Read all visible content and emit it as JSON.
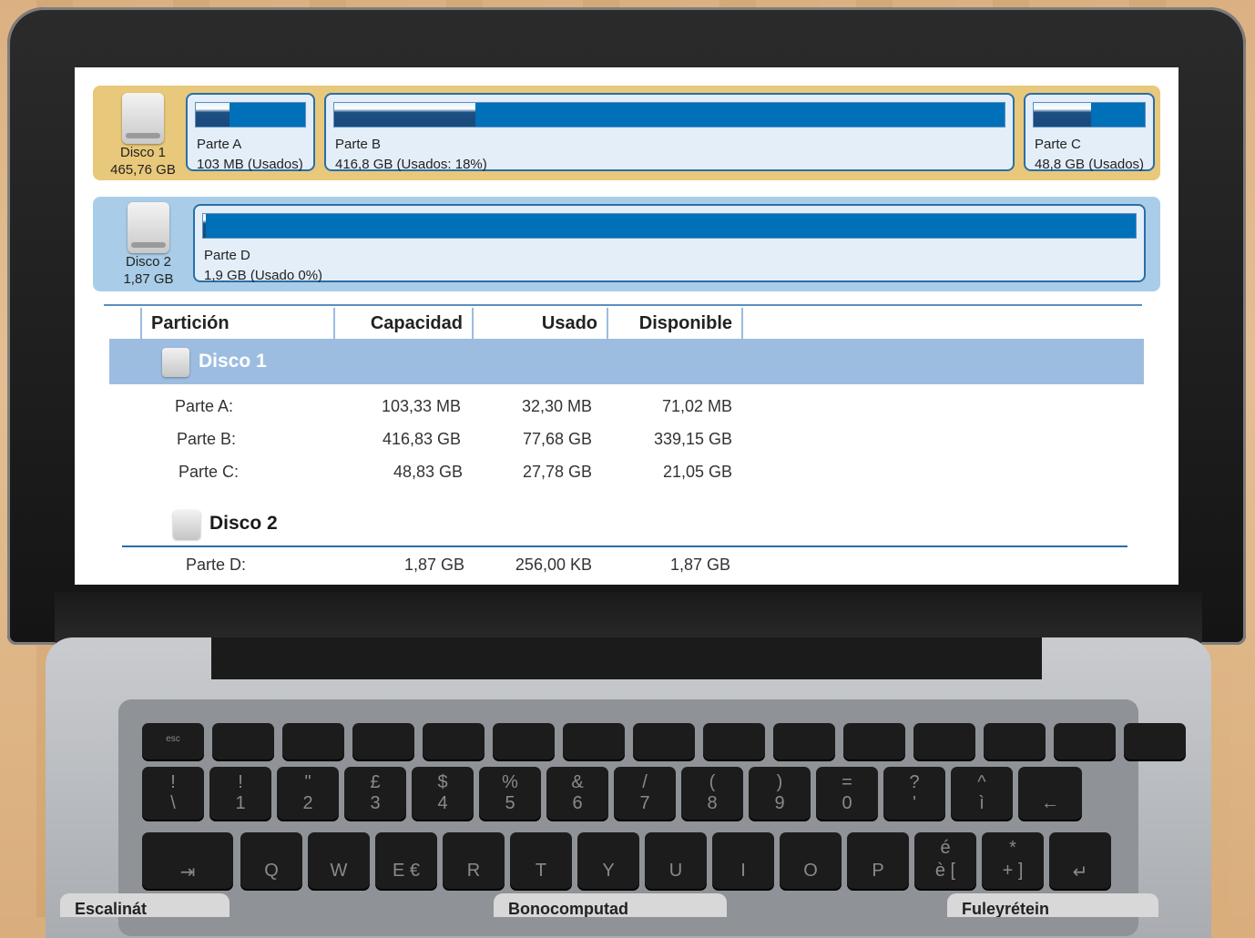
{
  "disks": [
    {
      "name": "Disco 1",
      "size": "465,76 GB",
      "partitions": [
        {
          "name": "Parte A",
          "info": "103 MB (Usados)",
          "used_fraction": 0.31
        },
        {
          "name": "Parte B",
          "info": "416,8 GB (Usados: 18%)",
          "used_fraction": 0.21
        },
        {
          "name": "Parte C",
          "info": "48,8 GB (Usados)",
          "used_fraction": 0.52
        }
      ]
    },
    {
      "name": "Disco 2",
      "size": "1,87 GB",
      "partitions": [
        {
          "name": "Parte D",
          "info": "1,9 GB (Usado 0%)",
          "used_fraction": 0.0
        }
      ]
    }
  ],
  "table": {
    "headers": [
      "Partición",
      "Capacidad",
      "Usado",
      "Disponible"
    ],
    "groups": [
      {
        "title": "Disco 1",
        "rows": [
          {
            "partition": "Parte A:",
            "capacity": "103,33 MB",
            "used": "32,30 MB",
            "available": "71,02 MB"
          },
          {
            "partition": "Parte B:",
            "capacity": "416,83 GB",
            "used": "77,68 GB",
            "available": "339,15 GB"
          },
          {
            "partition": "Parte C:",
            "capacity": "48,83 GB",
            "used": "27,78 GB",
            "available": "21,05 GB"
          }
        ]
      },
      {
        "title": "Disco 2",
        "rows": [
          {
            "partition": "Parte D:",
            "capacity": "1,87 GB",
            "used": "256,00 KB",
            "available": "1,87 GB"
          }
        ]
      }
    ]
  },
  "keyboard": {
    "fn_row": [
      "esc",
      "",
      "",
      "",
      "",
      "",
      "",
      "",
      "",
      "",
      "",
      "",
      "",
      "",
      ""
    ],
    "num_row": [
      [
        "!",
        "\\"
      ],
      [
        "!",
        "1"
      ],
      [
        "\"",
        "2"
      ],
      [
        "£",
        "3"
      ],
      [
        "$",
        "4"
      ],
      [
        "%",
        "5"
      ],
      [
        "&",
        "6"
      ],
      [
        "/",
        "7"
      ],
      [
        "(",
        "8"
      ],
      [
        ")",
        "9"
      ],
      [
        "=",
        "0"
      ],
      [
        "?",
        "'"
      ],
      [
        "^",
        "ì"
      ],
      [
        "",
        "←"
      ]
    ],
    "q_row": [
      [
        "",
        "⇥"
      ],
      [
        "",
        "Q"
      ],
      [
        "",
        "W"
      ],
      [
        "",
        "E €"
      ],
      [
        "",
        "R"
      ],
      [
        "",
        "T"
      ],
      [
        "",
        "Y"
      ],
      [
        "",
        "U"
      ],
      [
        "",
        "I"
      ],
      [
        "",
        "O"
      ],
      [
        "",
        "P"
      ],
      [
        "é",
        "è ["
      ],
      [
        "*",
        "+ ]"
      ],
      [
        "",
        "↵"
      ]
    ]
  },
  "bottom_labels": [
    "Escalinát",
    "Bonocomputad",
    "Fuleyrétein"
  ],
  "colors": {
    "disk1_band": "#e8c87a",
    "disk2_band": "#a9cde8",
    "partition_bar": "#0070b8",
    "group_highlight": "#9dbde0"
  }
}
